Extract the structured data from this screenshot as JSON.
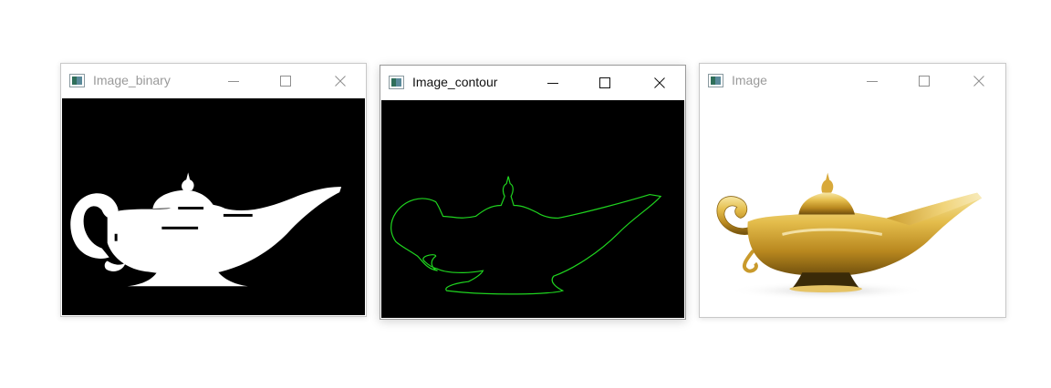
{
  "windows": [
    {
      "title": "Image_binary",
      "state": "inactive",
      "content": "binary-silhouette"
    },
    {
      "title": "Image_contour",
      "state": "active",
      "content": "green-contour"
    },
    {
      "title": "Image",
      "state": "inactive",
      "content": "golden-lamp-photo"
    }
  ],
  "colors": {
    "contour": "#1fd51f",
    "silhouette": "#ffffff",
    "background_dark": "#000000",
    "gold_light": "#f4dc8a",
    "gold_dark": "#8a6412"
  },
  "icons": [
    "app-icon",
    "minimize-icon",
    "maximize-icon",
    "close-icon"
  ]
}
